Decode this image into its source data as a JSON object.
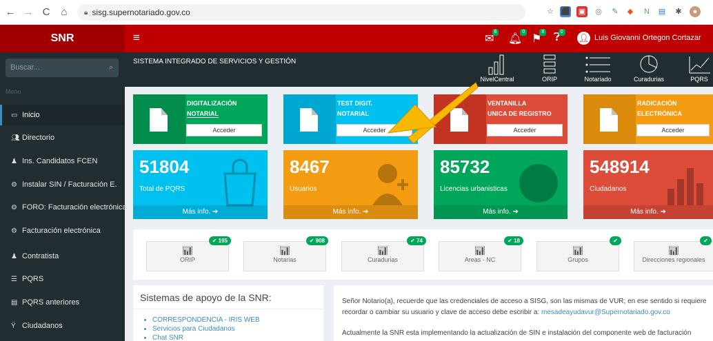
{
  "browser": {
    "url": "sisg.supernotariado.gov.co",
    "nav": {
      "back": "←",
      "forward": "→",
      "reload": "C",
      "home": "⌂"
    }
  },
  "header": {
    "logo": "SNR",
    "menu_glyph": "≡",
    "user_name": "Luis Giovanni Ortegon Cortazar",
    "badges": [
      "6",
      "0",
      "8",
      "0"
    ]
  },
  "sidebar": {
    "search_placeholder": "Buscar...",
    "menu_header": "Menu",
    "items": [
      {
        "label": "Inicio",
        "icon": "monitor-icon"
      },
      {
        "label": "Directorio",
        "icon": "users-icon"
      },
      {
        "label": "Ins. Candidatos FCEN",
        "icon": "user-icon"
      },
      {
        "label": "Instalar SIN / Facturación E.",
        "icon": "cogs-icon"
      },
      {
        "label": "FORO: Facturación electrónica",
        "icon": "cogs-icon"
      },
      {
        "label": "Facturación electrónica",
        "icon": "cogs-icon"
      },
      {
        "label": "Contratista",
        "icon": "user-icon"
      },
      {
        "label": "PQRS",
        "icon": "list-icon"
      },
      {
        "label": "PQRS anteriores",
        "icon": "list-icon"
      },
      {
        "label": "Ciudadanos",
        "icon": "torch-icon"
      }
    ]
  },
  "strip": {
    "title": "SISTEMA INTEGRADO DE SERVICIOS Y GESTIÓN",
    "icons": [
      {
        "label": "NivelCentral"
      },
      {
        "label": "ORIP"
      },
      {
        "label": "Notariado"
      },
      {
        "label": "Curadurias"
      },
      {
        "label": "PQRS"
      }
    ]
  },
  "doc_boxes": [
    {
      "title1": "DIGITALIZACIÓN",
      "title2": "NOTARIAL",
      "button": "Acceder",
      "color": "#00a65a",
      "dark": "#008d4c"
    },
    {
      "title1": "TEST DIGIT.",
      "title2": "NOTARIAL",
      "button": "Acceder",
      "color": "#00c0ef",
      "dark": "#00a7d0"
    },
    {
      "title1": "VENTANILLA",
      "title2": "UNICA DE REGISTRO",
      "button": "Acceder",
      "color": "#dd4b39",
      "dark": "#c23321"
    },
    {
      "title1": "RADICACIÓN",
      "title2": "ELECTRÓNICA",
      "button": "Acceder",
      "color": "#f39c12",
      "dark": "#db8b0b"
    }
  ],
  "stat_boxes": [
    {
      "value": "51804",
      "label": "Total de PQRS",
      "more": "Más info. ➔",
      "color": "#00c0ef"
    },
    {
      "value": "8467",
      "label": "Usuarios",
      "more": "Más info. ➔",
      "color": "#f39c12"
    },
    {
      "value": "85732",
      "label": "Licencias urbanisticas",
      "more": "Más info. ➔",
      "color": "#00a65a"
    },
    {
      "value": "548914",
      "label": "Ciudadanos",
      "more": "Más info. ➔",
      "color": "#dd4b39"
    }
  ],
  "shortcuts": [
    {
      "label": "ORIP",
      "badge": "✔ 195"
    },
    {
      "label": "Notarias",
      "badge": "✔ 908"
    },
    {
      "label": "Curadurias",
      "badge": "✔ 74"
    },
    {
      "label": "Areas - NC",
      "badge": "✔ 18"
    },
    {
      "label": "Grupos",
      "badge": "✔"
    },
    {
      "label": "Direcciones regionales",
      "badge": "✔"
    }
  ],
  "support": {
    "title": "Sistemas de apoyo de la SNR:",
    "links": [
      "CORRESPONDENCIA - IRIS WEB",
      "Servicios para Ciudadanos",
      "Chat SNR"
    ]
  },
  "notice": {
    "text1": "Señor Notario(a), recuerde que las credenciales de acceso a SISG, son las mismas de VUR; en ese sentido si requiere",
    "text2": "recordar o cambiar su usuario y clave de acceso debe escribir a:",
    "email": "mesadeayudavur@Supernotariado.gov.co",
    "text3": "Actualmente la SNR esta implementando la actualización de SIN e instalación del componente web de facturación"
  },
  "colors": {
    "arrow": "#f7b900",
    "header": "#c00000",
    "sidebar": "#222d32"
  }
}
